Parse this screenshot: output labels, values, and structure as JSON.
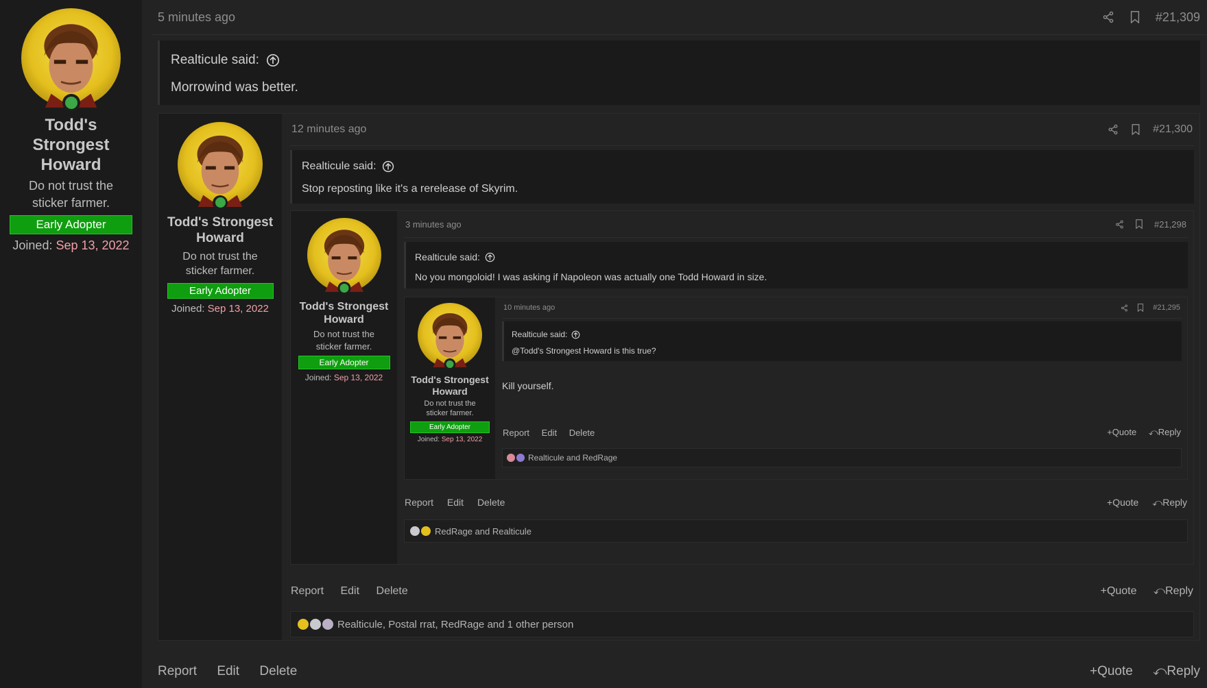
{
  "user": {
    "name": "Todd's Strongest Howard",
    "title": "Do not trust the sticker farmer.",
    "badge": "Early Adopter",
    "joined_label": "Joined:",
    "joined_date": "Sep 13, 2022"
  },
  "labels": {
    "report": "Report",
    "edit": "Edit",
    "delete": "Delete",
    "quote": "Quote",
    "reply": "Reply",
    "said": "said:"
  },
  "posts": [
    {
      "time": "5 minutes ago",
      "number": "#21,309",
      "quote_author": "Realticule",
      "quote_text": "Morrowind was better.",
      "reactions": ""
    },
    {
      "time": "12 minutes ago",
      "number": "#21,300",
      "quote_author": "Realticule",
      "quote_text": "Stop reposting like it's a rerelease of Skyrim.",
      "reactions": "Realticule, Postal rrat, RedRage and 1 other person"
    },
    {
      "time": "3 minutes ago",
      "number": "#21,298",
      "quote_author": "Realticule",
      "quote_text": "No you mongoloid! I was asking if Napoleon was actually one Todd Howard in size.",
      "reactions": "RedRage and Realticule"
    },
    {
      "time": "10 minutes ago",
      "number": "#21,295",
      "quote_author": "Realticule",
      "quote_text": "@Todd's Strongest Howard is this true?",
      "body": "Kill yourself.",
      "reactions": "Realticule and RedRage"
    }
  ],
  "colors": {
    "badge_green": "#0f9e0f",
    "joined_date": "#f0a0a8",
    "online_dot": "#3ba845",
    "avatar_gold": "#e4bf1e"
  }
}
